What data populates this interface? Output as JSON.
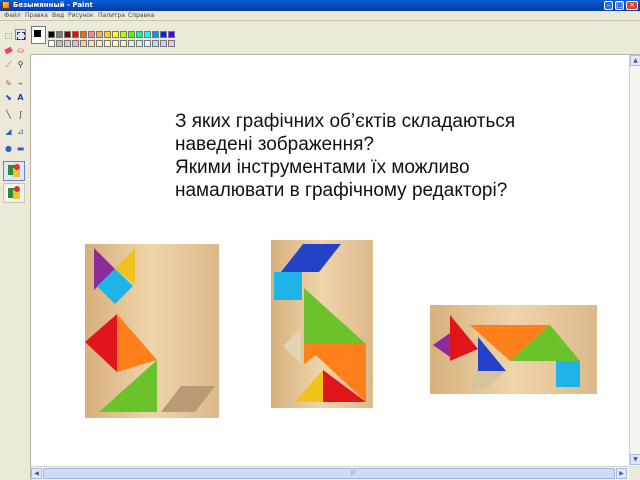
{
  "window": {
    "title": "Безымянный - Paint",
    "colors": {
      "titlebar": "#0746b8",
      "canvas": "#ffffff",
      "chrome": "#ece9d8"
    }
  },
  "menu": {
    "items": [
      "Файл",
      "Правка",
      "Вид",
      "Рисунок",
      "Палитра",
      "Справка"
    ]
  },
  "tools": [
    "free-select-icon",
    "rect-select-icon",
    "eraser-icon",
    "fill-icon",
    "picker-icon",
    "magnifier-icon",
    "pencil-icon",
    "brush-icon",
    "airbrush-icon",
    "text-icon",
    "line-icon",
    "curve-icon",
    "rectangle-icon",
    "polygon-icon",
    "ellipse-icon",
    "rounded-rect-icon"
  ],
  "palette": {
    "row1": [
      "#000000",
      "#7f7f7f",
      "#7f0000",
      "#ff0000",
      "#ff6a00",
      "#ff8c8c",
      "#ffaa55",
      "#ffd800",
      "#ffff00",
      "#b6ff00",
      "#4cff00",
      "#00ff90",
      "#00ffff",
      "#0094ff",
      "#0026ff",
      "#4800ff"
    ],
    "row2": [
      "#ffffff",
      "#c0c0c0",
      "#cfcfcf",
      "#ffb3b3",
      "#ffcc99",
      "#ffe0b3",
      "#ffeecc",
      "#fff5b3",
      "#ffffcc",
      "#e5ffb3",
      "#ccffcc",
      "#b3ffe0",
      "#ccffff",
      "#b3d9ff",
      "#ccccff",
      "#e0ccff"
    ]
  },
  "question": {
    "lines": [
      "З яких графічних об’єктів складаються",
      "наведені зображення?",
      "Якими інструментами їх можливо",
      "намалювати в графічному редакторі?"
    ]
  },
  "figures": [
    {
      "name": "fox-tangram",
      "subject": "fox"
    },
    {
      "name": "goose-tangram",
      "subject": "goose"
    },
    {
      "name": "dog-tangram",
      "subject": "dog"
    }
  ],
  "tangram_colors": {
    "purple": "#8b2c9c",
    "yellow": "#f0c21c",
    "cyan": "#1fb4e8",
    "red": "#e0161c",
    "orange": "#ff7f1a",
    "green": "#6cc22a",
    "blue": "#2342c8",
    "beige": "#dcc8a6",
    "wood": "#e9c99a"
  }
}
